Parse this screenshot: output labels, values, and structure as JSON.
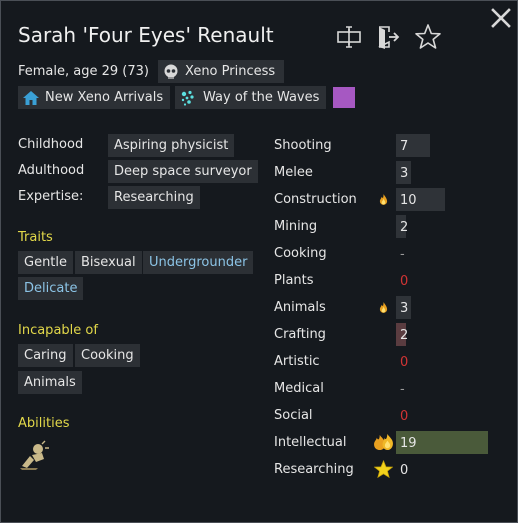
{
  "character": {
    "name": "Sarah 'Four Eyes' Renault",
    "subtitle": "Female, age 29 (73)",
    "xenotype": "Xeno Princess",
    "faction": "New Xeno Arrivals",
    "ideoligion": "Way of the Waves",
    "favorite_color": "#a658c2"
  },
  "backstory": {
    "childhood_label": "Childhood",
    "childhood": "Aspiring physicist",
    "adulthood_label": "Adulthood",
    "adulthood": "Deep space surveyor",
    "expertise_label": "Expertise:",
    "expertise": "Researching"
  },
  "traits": {
    "heading": "Traits",
    "items": [
      "Gentle",
      "Bisexual",
      "Undergrounder",
      "Delicate"
    ]
  },
  "incapable": {
    "heading": "Incapable of",
    "items": [
      "Caring",
      "Cooking",
      "Animals"
    ]
  },
  "abilities": {
    "heading": "Abilities"
  },
  "skills": [
    {
      "name": "Shooting",
      "value": "7",
      "level": 7,
      "passion": "none"
    },
    {
      "name": "Melee",
      "value": "3",
      "level": 3,
      "passion": "none"
    },
    {
      "name": "Construction",
      "value": "10",
      "level": 10,
      "passion": "minor"
    },
    {
      "name": "Mining",
      "value": "2",
      "level": 2,
      "passion": "none"
    },
    {
      "name": "Cooking",
      "value": "-",
      "level": null,
      "passion": "none"
    },
    {
      "name": "Plants",
      "value": "0",
      "level": 0,
      "passion": "none"
    },
    {
      "name": "Animals",
      "value": "3",
      "level": 3,
      "passion": "minor"
    },
    {
      "name": "Crafting",
      "value": "2",
      "level": 2,
      "passion": "none"
    },
    {
      "name": "Artistic",
      "value": "0",
      "level": 0,
      "passion": "none"
    },
    {
      "name": "Medical",
      "value": "-",
      "level": null,
      "passion": "none"
    },
    {
      "name": "Social",
      "value": "0",
      "level": 0,
      "passion": "none"
    },
    {
      "name": "Intellectual",
      "value": "19",
      "level": 19,
      "passion": "major"
    },
    {
      "name": "Researching",
      "value": "0",
      "level": 0,
      "passion": "star"
    }
  ],
  "icons": {
    "close": "close-icon",
    "rename": "rename-icon",
    "banish": "banish-icon",
    "favorite": "star-outline-icon",
    "xenotype": "skull-icon",
    "faction": "home-icon",
    "ideoligion": "sparkle-icon",
    "ability": "ability-icon"
  }
}
